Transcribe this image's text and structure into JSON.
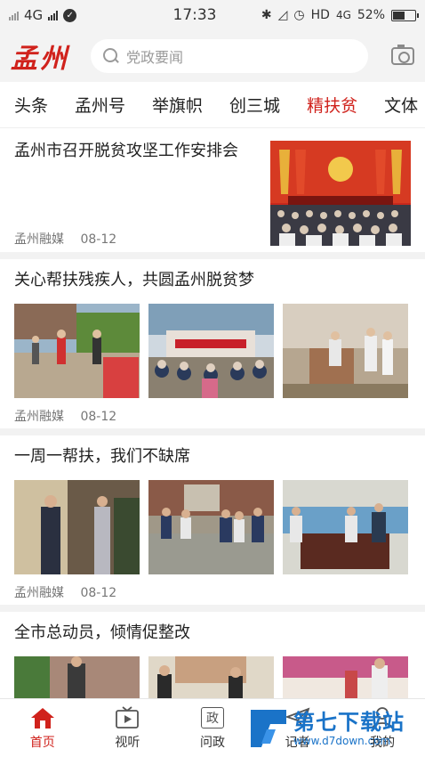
{
  "status": {
    "network_left": "4G",
    "time": "17:33",
    "network_right": "HD",
    "network_right_2": "4G",
    "battery": "52%"
  },
  "header": {
    "logo": "孟州",
    "search_placeholder": "党政要闻"
  },
  "tabs": [
    "头条",
    "孟州号",
    "举旗帜",
    "创三城",
    "精扶贫",
    "文体"
  ],
  "active_tab": 4,
  "articles": [
    {
      "title": "孟州市召开脱贫攻坚工作安排会",
      "source": "孟州融媒",
      "date": "08-12"
    },
    {
      "title": "关心帮扶残疾人，共圆孟州脱贫梦",
      "source": "孟州融媒",
      "date": "08-12"
    },
    {
      "title": "一周一帮扶，我们不缺席",
      "source": "孟州融媒",
      "date": "08-12"
    },
    {
      "title": "全市总动员，倾情促整改",
      "source": "",
      "date": ""
    }
  ],
  "bottom_nav": [
    {
      "label": "首页",
      "icon": "home-icon"
    },
    {
      "label": "视听",
      "icon": "tv-icon"
    },
    {
      "label": "问政",
      "icon": "zheng-icon",
      "glyph": "政"
    },
    {
      "label": "记者",
      "icon": "plane-icon"
    },
    {
      "label": "我的",
      "icon": "user-icon"
    }
  ],
  "watermark": {
    "title": "第七下载站",
    "url": "www.d7down.com"
  },
  "colors": {
    "accent": "#d0221c",
    "watermark": "#1a73c8"
  }
}
